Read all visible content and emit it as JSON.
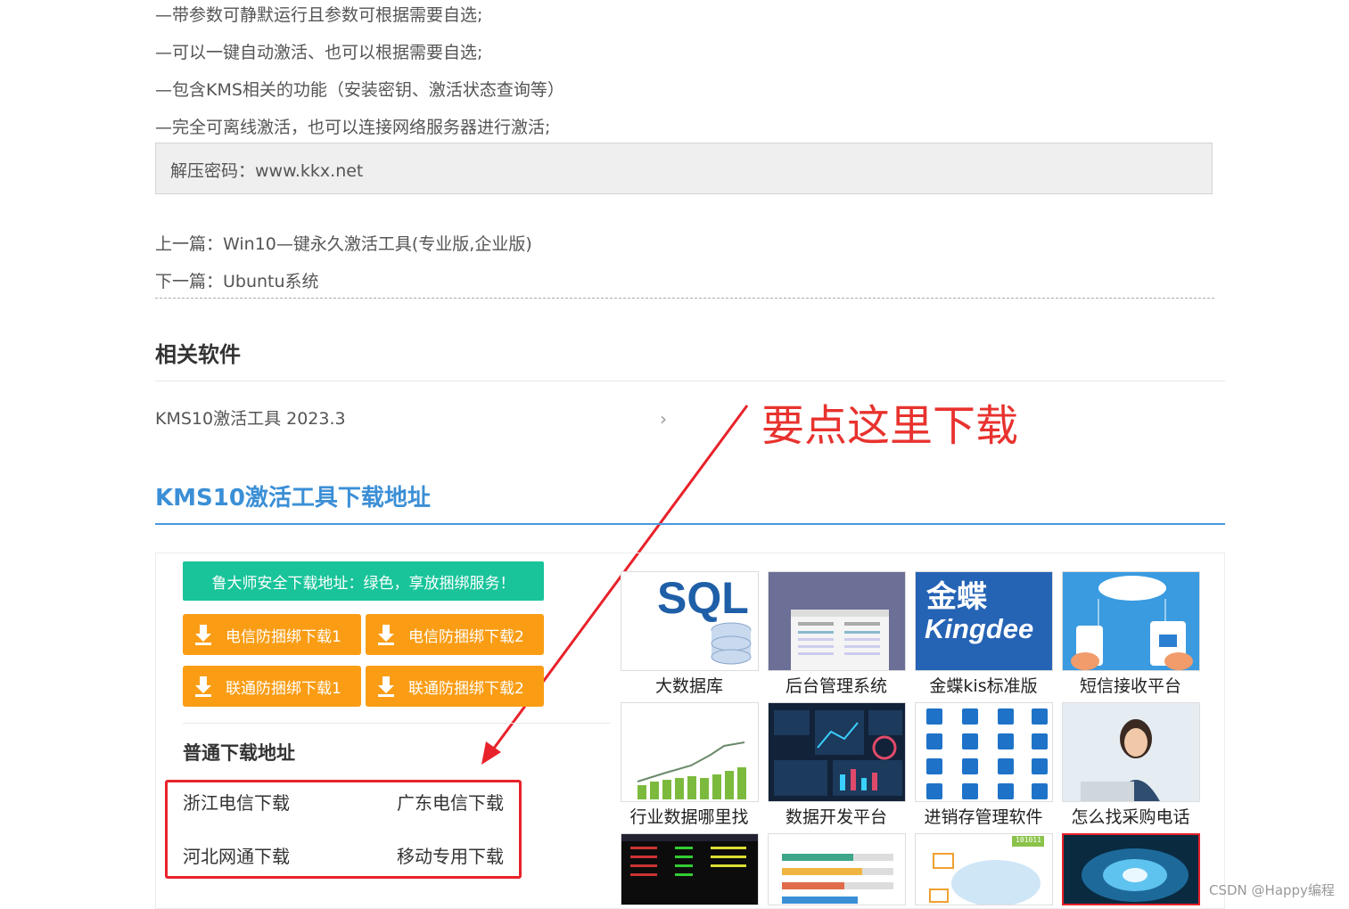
{
  "features": [
    "—带参数可静默运行且参数可根据需要自选;",
    "—可以一键自动激活、也可以根据需要自选;",
    "—包含KMS相关的功能（安装密钥、激活状态查询等）",
    "—完全可离线激活，也可以连接网络服务器进行激活;"
  ],
  "password_line": "解压密码：www.kkx.net",
  "prev_article": "上一篇：Win10—键永久激活工具(专业版,企业版)",
  "next_article": "下一篇：Ubuntu系统",
  "related": {
    "heading": "相关软件",
    "item": "KMS10激活工具 2023.3",
    "chevron": "›"
  },
  "annotation": "要点这里下载",
  "download": {
    "title": "KMS10激活工具下载地址",
    "green_bar": "鲁大师安全下载地址：绿色，享放捆绑服务！",
    "buttons": [
      "电信防捆绑下载1",
      "电信防捆绑下载2",
      "联通防捆绑下载1",
      "联通防捆绑下载2"
    ],
    "normal_heading": "普通下载地址",
    "mirrors": [
      "浙江电信下载",
      "广东电信下载",
      "河北网通下载",
      "移动专用下载"
    ]
  },
  "ads": [
    {
      "caption": "大数据库",
      "art": "SQL"
    },
    {
      "caption": "后台管理系统"
    },
    {
      "caption": "金蝶kis标准版",
      "art_top": "金蝶",
      "art_bottom": "Kingdee"
    },
    {
      "caption": "短信接收平台"
    },
    {
      "caption": "行业数据哪里找"
    },
    {
      "caption": "数据开发平台"
    },
    {
      "caption": "进销存管理软件"
    },
    {
      "caption": "怎么找采购电话"
    }
  ],
  "bottom_tiles": [
    {
      "art": "101011"
    }
  ],
  "watermark": "CSDN @Happy编程",
  "colors": {
    "accent_blue": "#3b8fd6",
    "green": "#19c49a",
    "orange": "#fa9d15",
    "annotation_red": "#e8322e"
  }
}
